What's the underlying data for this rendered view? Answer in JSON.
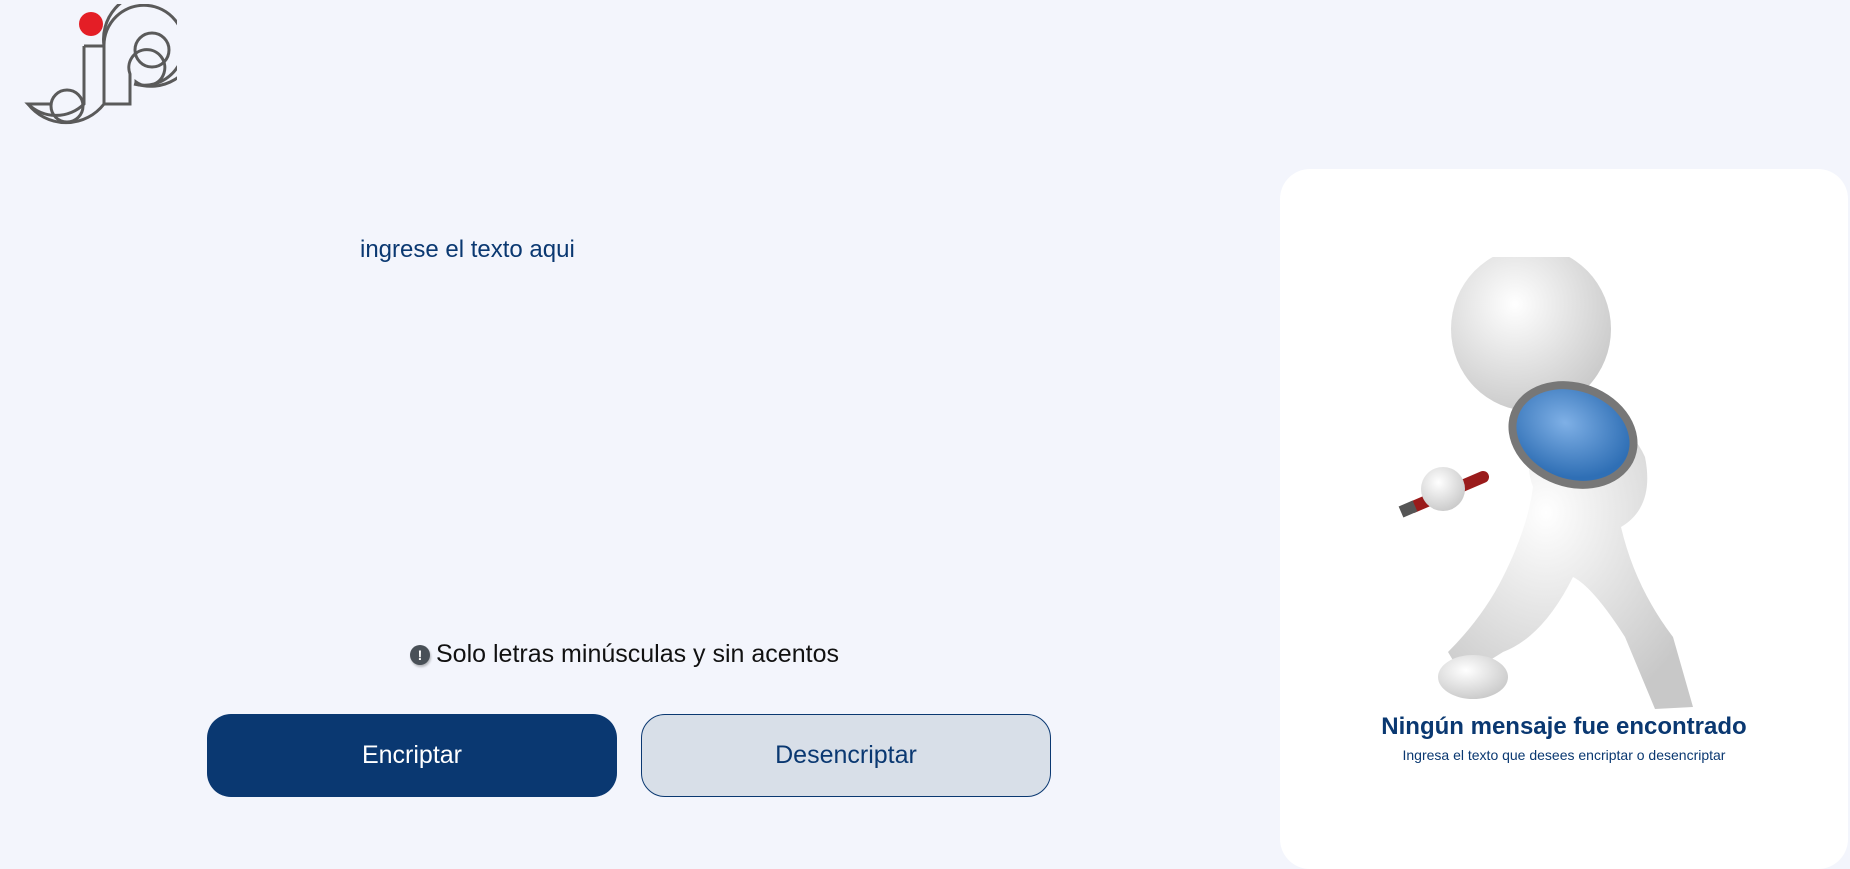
{
  "logo": {
    "text": "jp",
    "accent_color": "#e41e26"
  },
  "input": {
    "placeholder": "ingrese el texto aqui",
    "value": ""
  },
  "warning": {
    "icon": "exclamation-circle-icon",
    "text": "Solo letras minúsculas y sin acentos"
  },
  "buttons": {
    "encrypt_label": "Encriptar",
    "decrypt_label": "Desencriptar"
  },
  "result_panel": {
    "title": "Ningún mensaje fue encontrado",
    "subtitle": "Ingresa el texto que desees encriptar o desencriptar"
  },
  "colors": {
    "primary": "#0a3871",
    "background": "#f3f5fc",
    "secondary_button": "#d8dfe8"
  }
}
